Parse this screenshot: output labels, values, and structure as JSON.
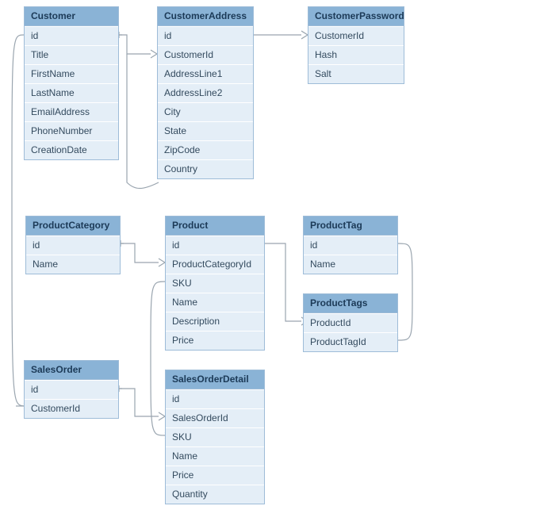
{
  "entities": {
    "customer": {
      "title": "Customer",
      "fields": [
        "id",
        "Title",
        "FirstName",
        "LastName",
        "EmailAddress",
        "PhoneNumber",
        "CreationDate"
      ]
    },
    "customerAddress": {
      "title": "CustomerAddress",
      "fields": [
        "id",
        "CustomerId",
        "AddressLine1",
        "AddressLine2",
        "City",
        "State",
        "ZipCode",
        "Country"
      ]
    },
    "customerPassword": {
      "title": "CustomerPassword",
      "fields": [
        "CustomerId",
        "Hash",
        "Salt"
      ]
    },
    "productCategory": {
      "title": "ProductCategory",
      "fields": [
        "id",
        "Name"
      ]
    },
    "product": {
      "title": "Product",
      "fields": [
        "id",
        "ProductCategoryId",
        "SKU",
        "Name",
        "Description",
        "Price"
      ]
    },
    "productTag": {
      "title": "ProductTag",
      "fields": [
        "id",
        "Name"
      ]
    },
    "productTags": {
      "title": "ProductTags",
      "fields": [
        "ProductId",
        "ProductTagId"
      ]
    },
    "salesOrder": {
      "title": "SalesOrder",
      "fields": [
        "id",
        "CustomerId"
      ]
    },
    "salesOrderDetail": {
      "title": "SalesOrderDetail",
      "fields": [
        "id",
        "SalesOrderId",
        "SKU",
        "Name",
        "Price",
        "Quantity"
      ]
    }
  },
  "relationships": [
    {
      "from": "Customer.id",
      "to": "CustomerAddress.CustomerId",
      "type": "one-to-many"
    },
    {
      "from": "Customer.id",
      "to": "CustomerPassword.CustomerId",
      "type": "one-to-one"
    },
    {
      "from": "Customer.id",
      "to": "SalesOrder.CustomerId",
      "type": "one-to-many"
    },
    {
      "from": "ProductCategory.id",
      "to": "Product.ProductCategoryId",
      "type": "one-to-many"
    },
    {
      "from": "Product.id",
      "to": "ProductTags.ProductId",
      "type": "one-to-many"
    },
    {
      "from": "ProductTag.id",
      "to": "ProductTags.ProductTagId",
      "type": "one-to-many"
    },
    {
      "from": "SalesOrder.id",
      "to": "SalesOrderDetail.SalesOrderId",
      "type": "one-to-many"
    },
    {
      "from": "Product.SKU",
      "to": "SalesOrderDetail.SKU",
      "type": "one-to-many"
    }
  ],
  "colors": {
    "headerBg": "#8ab3d6",
    "fieldBg": "#e4eef7",
    "border": "#9ebcd8",
    "connector": "#9aa5af"
  },
  "chart_data": {
    "type": "table",
    "title": "Entity Relationship Diagram",
    "entities": [
      {
        "name": "Customer",
        "columns": [
          "id",
          "Title",
          "FirstName",
          "LastName",
          "EmailAddress",
          "PhoneNumber",
          "CreationDate"
        ]
      },
      {
        "name": "CustomerAddress",
        "columns": [
          "id",
          "CustomerId",
          "AddressLine1",
          "AddressLine2",
          "City",
          "State",
          "ZipCode",
          "Country"
        ]
      },
      {
        "name": "CustomerPassword",
        "columns": [
          "CustomerId",
          "Hash",
          "Salt"
        ]
      },
      {
        "name": "ProductCategory",
        "columns": [
          "id",
          "Name"
        ]
      },
      {
        "name": "Product",
        "columns": [
          "id",
          "ProductCategoryId",
          "SKU",
          "Name",
          "Description",
          "Price"
        ]
      },
      {
        "name": "ProductTag",
        "columns": [
          "id",
          "Name"
        ]
      },
      {
        "name": "ProductTags",
        "columns": [
          "ProductId",
          "ProductTagId"
        ]
      },
      {
        "name": "SalesOrder",
        "columns": [
          "id",
          "CustomerId"
        ]
      },
      {
        "name": "SalesOrderDetail",
        "columns": [
          "id",
          "SalesOrderId",
          "SKU",
          "Name",
          "Price",
          "Quantity"
        ]
      }
    ],
    "relationships": [
      {
        "from": "Customer.id",
        "to": "CustomerAddress.CustomerId"
      },
      {
        "from": "Customer.id",
        "to": "CustomerPassword.CustomerId"
      },
      {
        "from": "Customer.id",
        "to": "SalesOrder.CustomerId"
      },
      {
        "from": "ProductCategory.id",
        "to": "Product.ProductCategoryId"
      },
      {
        "from": "Product.id",
        "to": "ProductTags.ProductId"
      },
      {
        "from": "ProductTag.id",
        "to": "ProductTags.ProductTagId"
      },
      {
        "from": "SalesOrder.id",
        "to": "SalesOrderDetail.SalesOrderId"
      },
      {
        "from": "Product.SKU",
        "to": "SalesOrderDetail.SKU"
      }
    ]
  }
}
